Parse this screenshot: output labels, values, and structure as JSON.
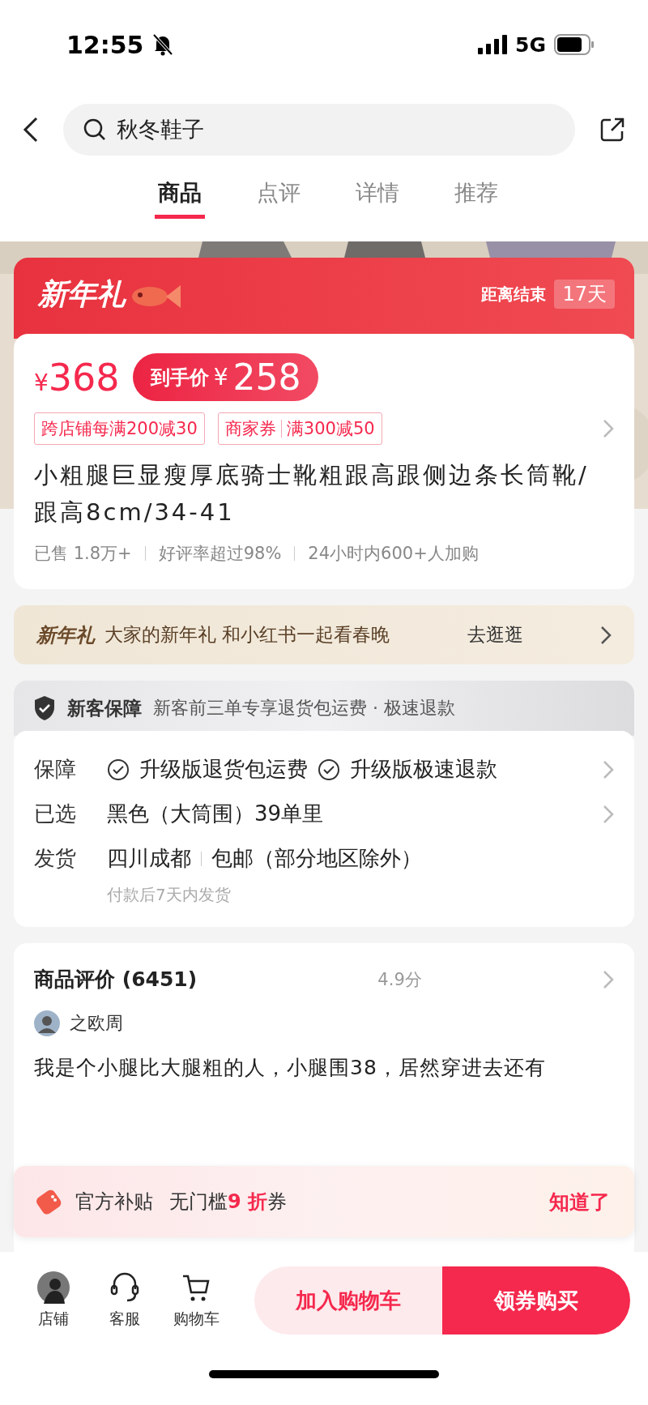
{
  "status_bar": {
    "time": "12:55",
    "network": "5G"
  },
  "header": {
    "search": {
      "value": "秋冬鞋子"
    }
  },
  "tabs": [
    {
      "label": "商品",
      "selected": true
    },
    {
      "label": "点评",
      "selected": false
    },
    {
      "label": "详情",
      "selected": false
    },
    {
      "label": "推荐",
      "selected": false
    }
  ],
  "hero_image": {
    "kind": "picture"
  },
  "promo": {
    "title": "新年礼",
    "countdown_label": "距离结束",
    "countdown": "17天"
  },
  "price": {
    "currency": "¥",
    "original": "368",
    "final_label": "到手价",
    "final_currency": "¥",
    "final": "258"
  },
  "coupons": [
    {
      "parts": [
        "跨店铺每满200减30"
      ]
    },
    {
      "parts": [
        "商家券",
        "满300减50"
      ]
    }
  ],
  "product_title": "小粗腿巨显瘦厚底骑士靴粗跟高跟侧边条长筒靴/跟高8cm/34-41",
  "stats": [
    "已售 1.8万+",
    "好评率超过98%",
    "24小时内600+人加购"
  ],
  "campaign": {
    "tag": "新年礼",
    "text": "大家的新年礼 和小红书一起看春晚",
    "link": "去逛逛"
  },
  "guarantee": {
    "title": "新客保障",
    "text": "新客前三单专享退货包运费 · 极速退款"
  },
  "details": [
    {
      "kind": "checks",
      "label": "保障",
      "items": [
        "升级版退货包运费",
        "升级版极速退款"
      ]
    },
    {
      "kind": "text",
      "label": "已选",
      "items": [
        "黑色（大筒围）39单里"
      ]
    },
    {
      "kind": "shipping",
      "label": "发货",
      "items": [
        "四川成都",
        "包邮（部分地区除外）"
      ],
      "note": "付款后7天内发货"
    }
  ],
  "reviews": {
    "title": "商品评价 (6451)",
    "score": "4.9分",
    "user": "之欧周",
    "text": "我是个小腿比大腿粗的人，小腿围38，居然穿进去还有"
  },
  "toast": {
    "label": "官方补贴",
    "prefix": "无门槛",
    "highlight": "9 折",
    "suffix": "券",
    "action": "知道了"
  },
  "bottom_bar": {
    "items": [
      {
        "kind": "avatar",
        "label": "店铺"
      },
      {
        "kind": "support",
        "label": "客服"
      },
      {
        "kind": "cart",
        "label": "购物车"
      }
    ],
    "add_to_cart": "加入购物车",
    "buy": "领券购买"
  }
}
